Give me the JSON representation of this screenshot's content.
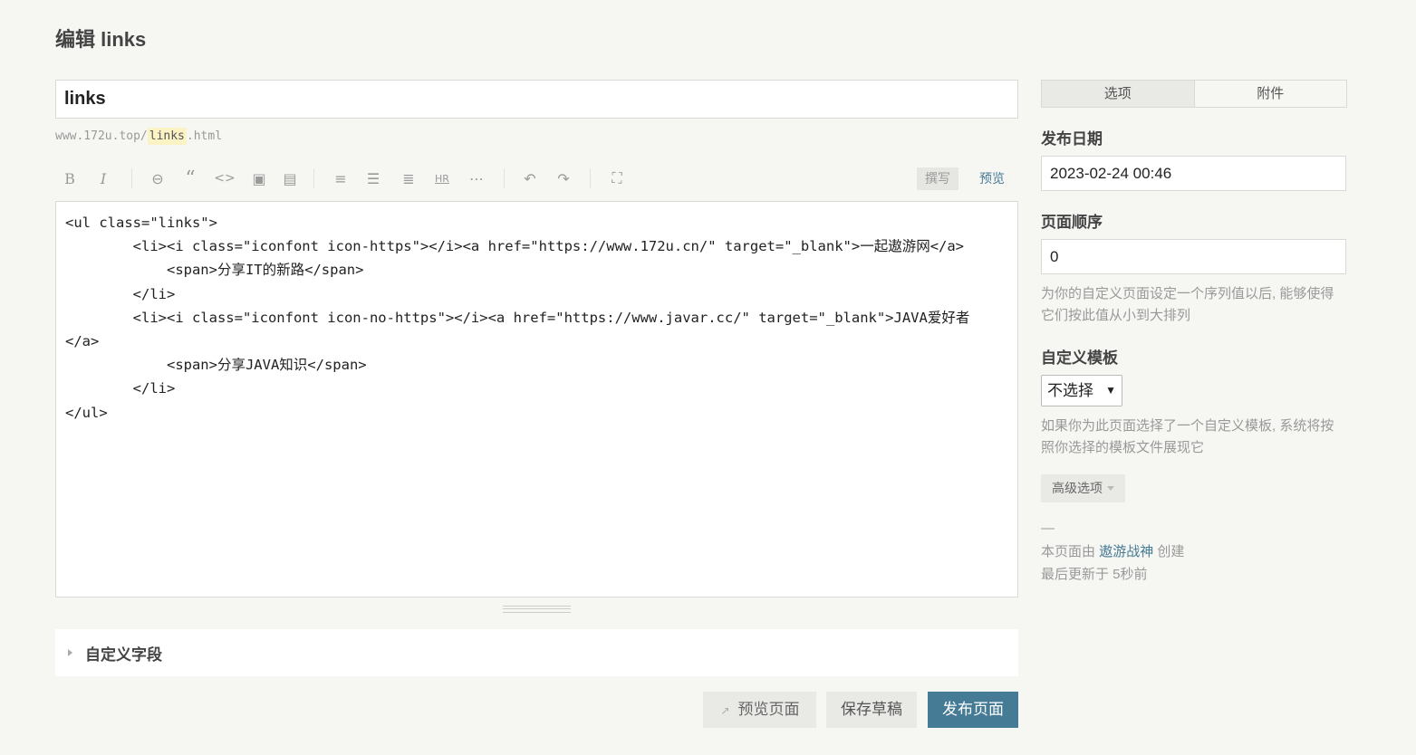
{
  "page": {
    "title": "编辑 links"
  },
  "editor": {
    "title_value": "links",
    "url_prefix": "www.172u.top/",
    "url_slug": "links",
    "url_suffix": ".html",
    "toolbar": {
      "buttons": [
        {
          "name": "bold-icon",
          "glyph": "B"
        },
        {
          "name": "italic-icon",
          "glyph": "I"
        },
        {
          "name": "link-icon",
          "glyph": "⊖"
        },
        {
          "name": "quote-icon",
          "glyph": "“"
        },
        {
          "name": "code-icon",
          "glyph": "<>"
        },
        {
          "name": "image-icon",
          "glyph": "▣"
        },
        {
          "name": "media-icon",
          "glyph": "▤"
        },
        {
          "name": "ordered-list-icon",
          "glyph": "≡"
        },
        {
          "name": "unordered-list-icon",
          "glyph": "☰"
        },
        {
          "name": "heading-icon",
          "glyph": "≣"
        },
        {
          "name": "hr-icon",
          "glyph": "HR"
        },
        {
          "name": "more-icon",
          "glyph": "⋯"
        },
        {
          "name": "undo-icon",
          "glyph": "↶"
        },
        {
          "name": "redo-icon",
          "glyph": "↷"
        },
        {
          "name": "fullscreen-icon",
          "glyph": "⛶"
        }
      ],
      "write_label": "撰写",
      "preview_label": "预览"
    },
    "content": "<ul class=\"links\">\n        <li><i class=\"iconfont icon-https\"></i><a href=\"https://www.172u.cn/\" target=\"_blank\">一起遨游网</a>\n            <span>分享IT的新路</span>\n        </li>\n        <li><i class=\"iconfont icon-no-https\"></i><a href=\"https://www.javar.cc/\" target=\"_blank\">JAVA爱好者\n</a>\n            <span>分享JAVA知识</span>\n        </li>\n</ul>",
    "custom_fields_label": "自定义字段"
  },
  "actions": {
    "preview_page": "预览页面",
    "save_draft": "保存草稿",
    "publish_page": "发布页面"
  },
  "sidebar": {
    "tabs": [
      {
        "label": "选项",
        "active": true
      },
      {
        "label": "附件",
        "active": false
      }
    ],
    "publish_date_label": "发布日期",
    "publish_date_value": "2023-02-24 00:46",
    "order_label": "页面顺序",
    "order_value": "0",
    "order_desc": "为你的自定义页面设定一个序列值以后, 能够使得它们按此值从小到大排列",
    "template_label": "自定义模板",
    "template_selected": "不选择",
    "template_desc": "如果你为此页面选择了一个自定义模板, 系统将按照你选择的模板文件展现它",
    "advanced_label": "高级选项",
    "dash": "—",
    "created_prefix": "本页面由",
    "author": "遨游战神",
    "created_suffix": "创建",
    "updated": "最后更新于 5秒前"
  },
  "colors": {
    "accent": "#467b96",
    "background": "#f6f6f3",
    "slug_highlight": "#fbf3c4"
  }
}
